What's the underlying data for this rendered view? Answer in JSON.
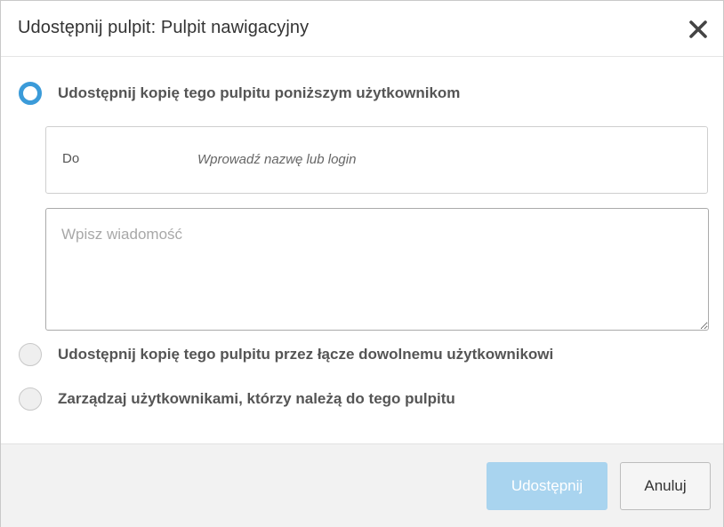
{
  "dialog": {
    "title": "Udostępnij pulpit: Pulpit nawigacyjny",
    "close_icon": "close-icon"
  },
  "options": [
    {
      "label": "Udostępnij kopię tego pulpitu poniższym użytkownikom",
      "selected": true
    },
    {
      "label": "Udostępnij kopię tego pulpitu przez łącze dowolnemu użytkownikowi",
      "selected": false
    },
    {
      "label": "Zarządzaj użytkownikami, którzy należą do tego pulpitu",
      "selected": false
    }
  ],
  "recipients": {
    "label": "Do",
    "placeholder": "Wprowadź nazwę lub login",
    "value": ""
  },
  "message": {
    "placeholder": "Wpisz wiadomość",
    "value": ""
  },
  "buttons": {
    "share_label": "Udostępnij",
    "share_enabled": false,
    "cancel_label": "Anuluj"
  },
  "colors": {
    "accent": "#3b9bd9",
    "primary_button_disabled": "#a9d4ef"
  }
}
